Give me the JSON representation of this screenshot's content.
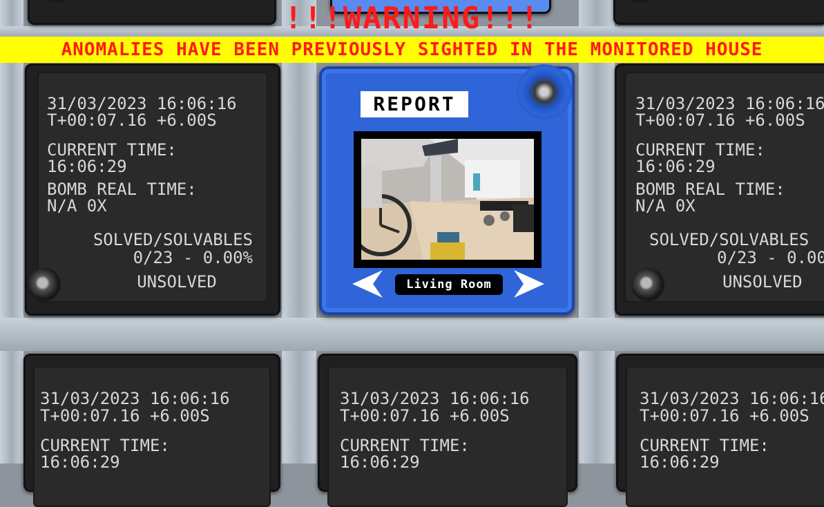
{
  "warning": {
    "title": "!!!WARNING!!!",
    "message": "ANOMALIES HAVE BEEN PREVIOUSLY SIGHTED IN THE MONITORED HOUSE"
  },
  "report_panel": {
    "label": "REPORT",
    "room_name": "Living Room",
    "prev_arrow": "previous-room",
    "next_arrow": "next-room"
  },
  "status_module": {
    "date_time": "31/03/2023 16:06:16",
    "elapsed": "T+00:07.16 +6.00S",
    "current_time_label": "CURRENT TIME:",
    "current_time": "16:06:29",
    "bomb_time_label": "BOMB REAL TIME:",
    "bomb_time": "N/A 0X",
    "solved_label": "SOLVED/SOLVABLES",
    "solved_value": "0/23 - 0.00%",
    "state": "UNSOLVED"
  },
  "colors": {
    "warning_red": "#ff1a1a",
    "warning_yellow": "#ffff00",
    "panel_blue": "#2f65d8",
    "lcd_text": "#d8d8d8"
  }
}
